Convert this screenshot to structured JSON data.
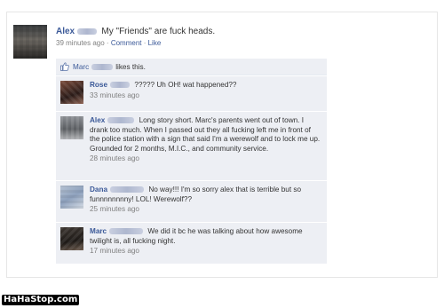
{
  "post": {
    "author": "Alex",
    "message": "My \"Friends\" are fuck heads.",
    "time": "39 minutes ago",
    "separator": " · ",
    "comment_link": "Comment",
    "like_link": "Like"
  },
  "likes": {
    "name": "Marc",
    "text": "likes this."
  },
  "comments": [
    {
      "name": "Rose",
      "text": "????? Uh OH! wat happened??",
      "time": "33 minutes ago"
    },
    {
      "name": "Alex",
      "text": "Long story short. Marc's parents went out of town. I drank too much. When I passed out they all fucking left me in front of the police station with a sign that said I'm a werewolf and to lock me up. Grounded for 2 months, M.I.C., and community service.",
      "time": "28 minutes ago"
    },
    {
      "name": "Dana",
      "text": "No way!!! I'm so sorry alex that is terrible but so funnnnnnnny! LOL! Werewolf??",
      "time": "25 minutes ago"
    },
    {
      "name": "Marc",
      "text": "We did it bc he was talking about how awesome twilight is, all fucking night.",
      "time": "17 minutes ago"
    }
  ],
  "watermark": "HaHaStop.com",
  "colors": {
    "link": "#3b5998",
    "comment_bg": "#edeff4",
    "meta": "#808080"
  }
}
